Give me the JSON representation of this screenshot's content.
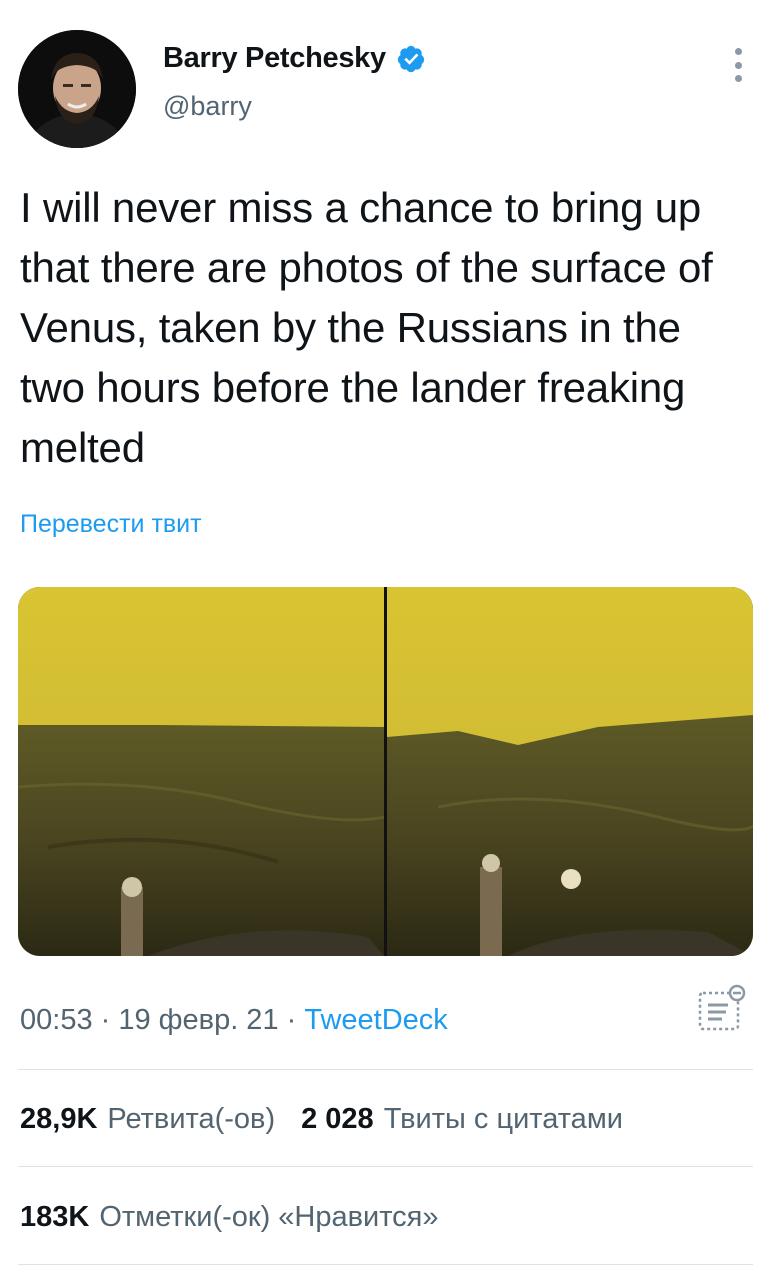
{
  "author": {
    "display_name": "Barry Petchesky",
    "handle": "@barry",
    "verified": true
  },
  "tweet": {
    "text": "I will never miss a chance to bring up that there are photos of the surface of Venus, taken by the Russians in the two hours before the lander freaking melted",
    "translate_label": "Перевести твит"
  },
  "meta": {
    "time": "00:53",
    "separator": " · ",
    "date": "19 февр. 21",
    "source": "TweetDeck"
  },
  "stats": {
    "retweets_count": "28,9K",
    "retweets_label": "Ретвита(-ов)",
    "quotes_count": "2 028",
    "quotes_label": "Твиты с цитатами",
    "likes_count": "183K",
    "likes_label": "Отметки(-ок) «Нравится»"
  },
  "colors": {
    "accent": "#1d9bf0",
    "secondary_text": "#536471",
    "venus_sky": "#d8c33a",
    "venus_ground": "#4d4a22"
  },
  "icons": [
    "verified-badge-icon",
    "more-options-icon",
    "analytics-icon"
  ]
}
